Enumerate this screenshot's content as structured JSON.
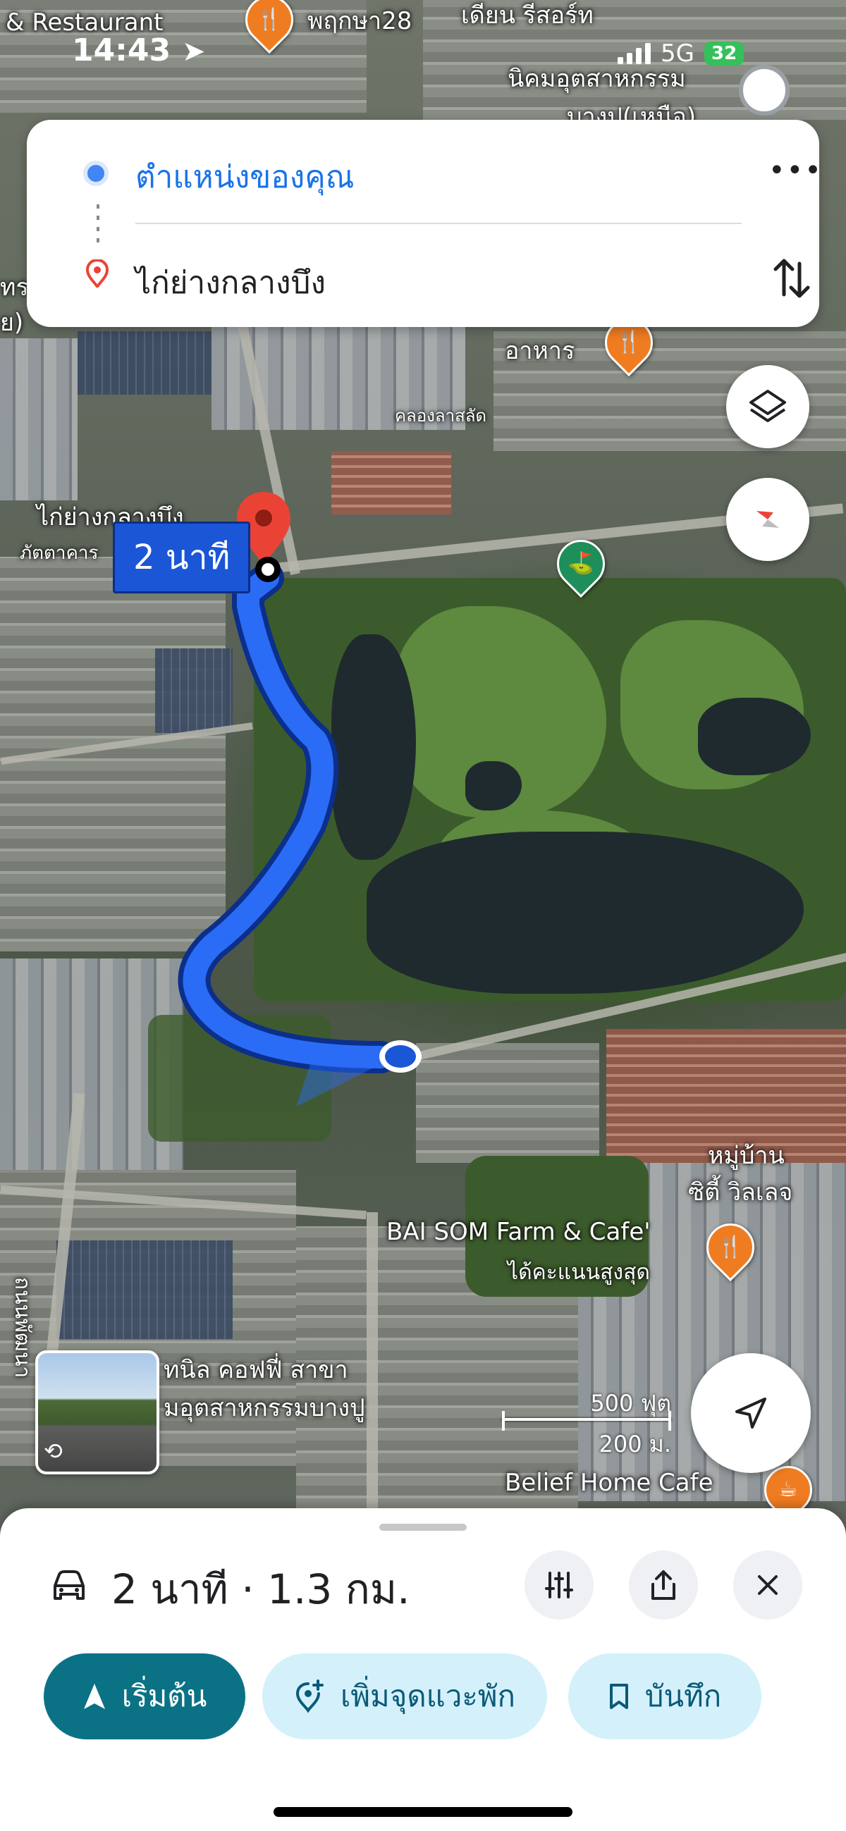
{
  "status_bar": {
    "time": "14:43",
    "network": "5G",
    "battery": "32"
  },
  "route_card": {
    "origin": "ตำแหน่งของคุณ",
    "destination": "ไก่ย่างกลางบึง"
  },
  "map": {
    "route_duration_label": "2 นาที",
    "labels": {
      "restaurant_top_left": "& Restaurant",
      "poi_top_center": "พฤกษา28",
      "poi_top_right": "เดียน รีสอร์ท",
      "industrial_top": "นิคมอุตสาหกรรม",
      "industrial_top_2": "บางปู(เหนือ)",
      "food": "อาหาร",
      "canal": "คลองลาสลัด",
      "dest_label_1": "ไก่ย่างกลางบึง",
      "dest_label_2": "ภัตตาคาร",
      "left_edge_1": "ทร",
      "left_edge_2": "ย)",
      "village_1": "หมู่บ้าน",
      "village_2": "ซิตี้ วิลเลจ",
      "baisom": "BAI SOM Farm & Cafe'",
      "baisom_sub": "ได้คะแนนสูงสุด",
      "coffee_1": "ทนิล คอฟฟี่ สาขา",
      "coffee_2": "มอุตสาหกรรมบางปู",
      "belief": "Belief Home Cafe",
      "road_vertical": "ถนนพัฒนา"
    },
    "scale": {
      "imperial": "500 ฟุต",
      "metric": "200 ม."
    }
  },
  "bottom_sheet": {
    "summary": "2 นาที · 1.3 กม.",
    "buttons": {
      "start": "เริ่มต้น",
      "add_stop": "เพิ่มจุดแวะพัก",
      "save": "บันทึก"
    }
  },
  "colors": {
    "route_blue": "#1a56d6",
    "start_button": "#0b7285",
    "secondary_button": "#d4f1fb",
    "poi_orange": "#f07c21",
    "dest_red": "#ea4335"
  }
}
